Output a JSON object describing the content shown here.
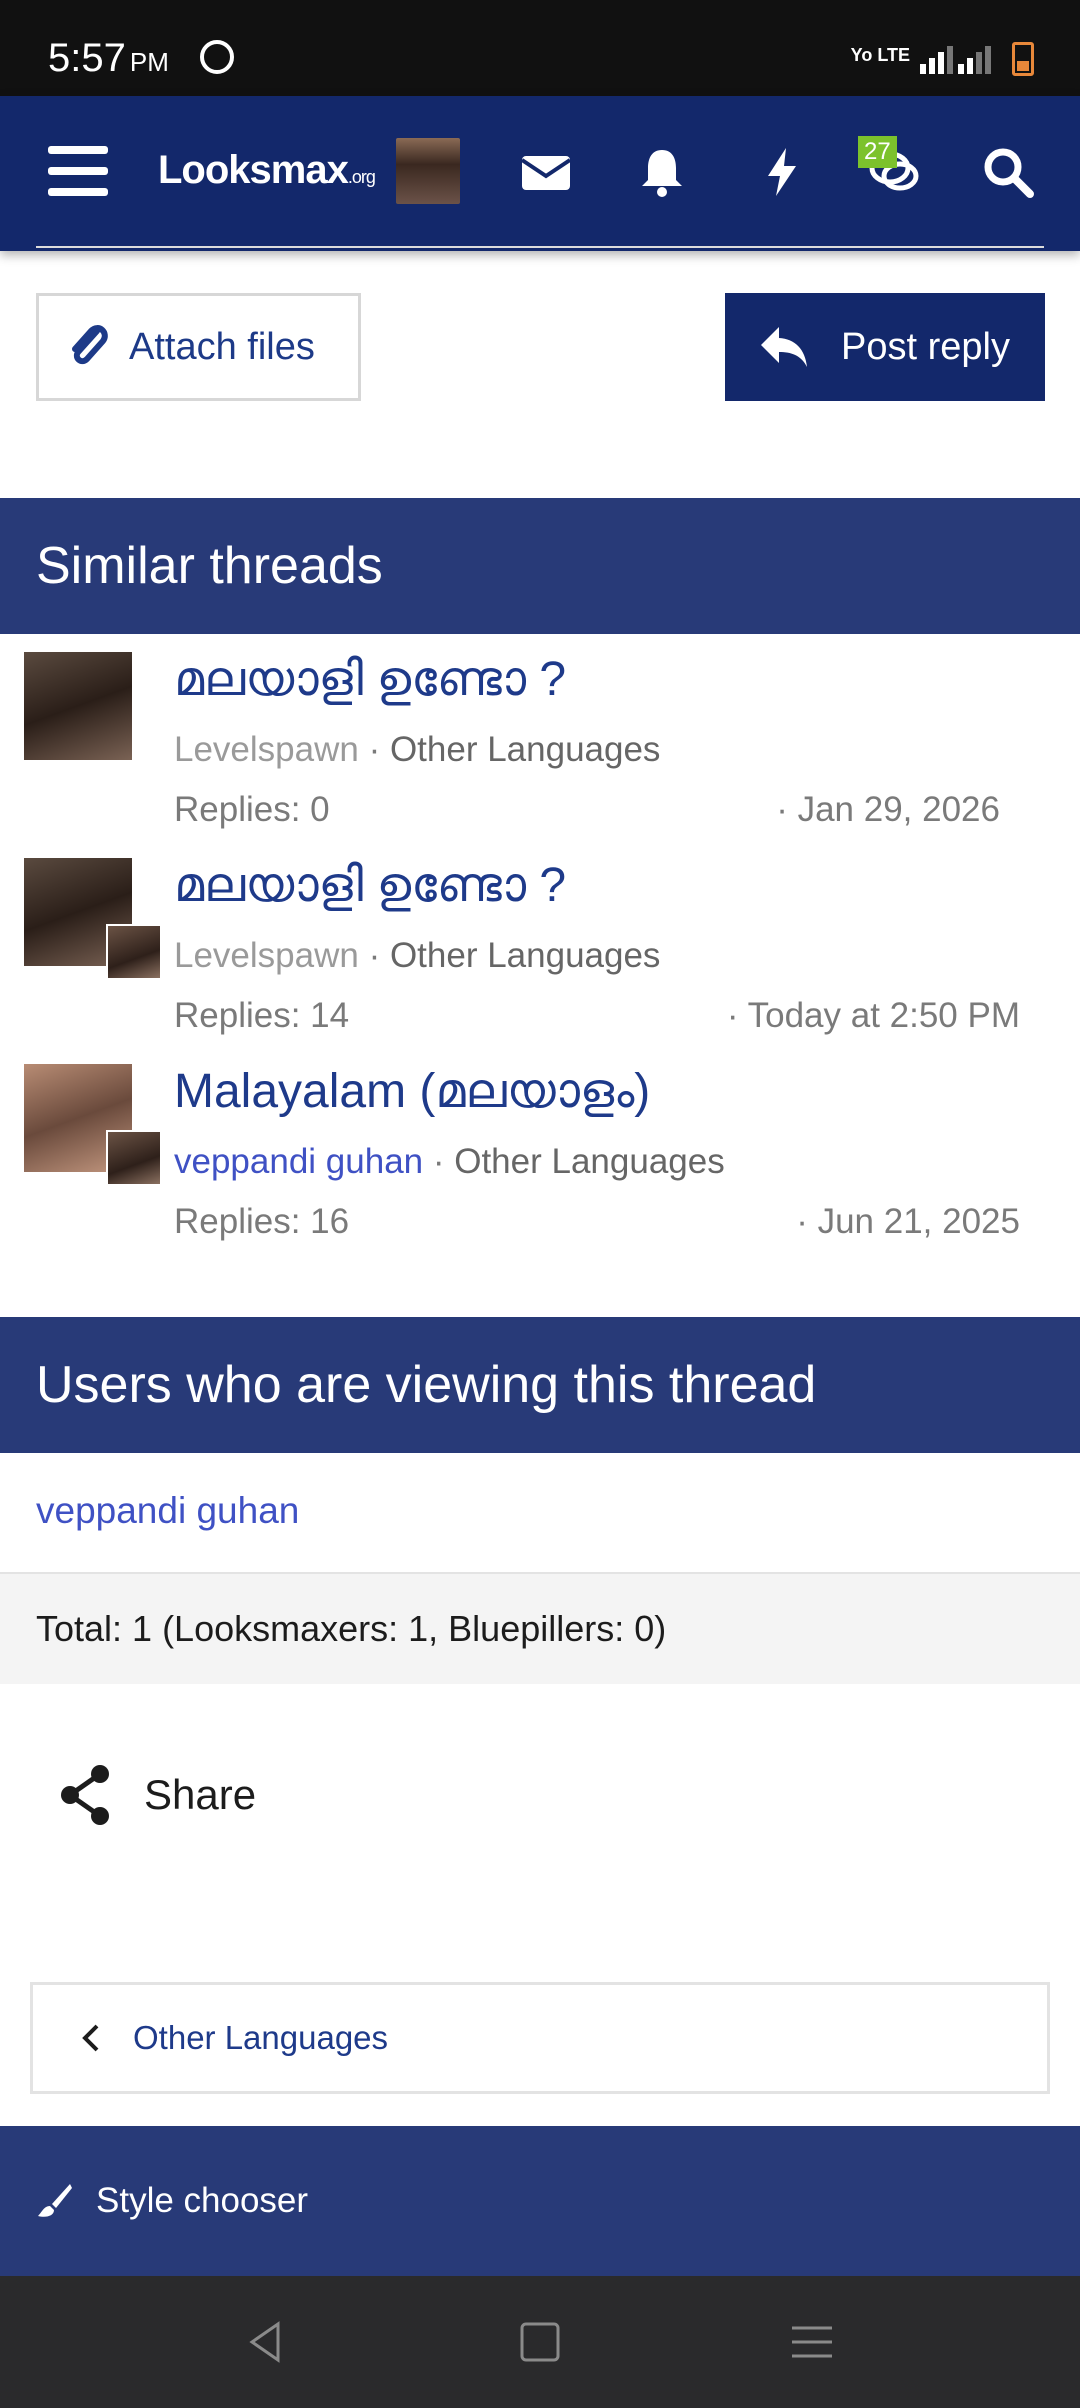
{
  "status_bar": {
    "time": "5:57",
    "ampm": "PM",
    "network": "Yo LTE",
    "lte": "LTE"
  },
  "header": {
    "logo_main": "Looksmax",
    "logo_suffix": ".org",
    "conversations_badge": "27",
    "icons": [
      "menu-icon",
      "avatar",
      "envelope-icon",
      "bell-icon",
      "lightning-icon",
      "chat-icon",
      "search-icon"
    ]
  },
  "actions": {
    "attach_label": "Attach files",
    "post_reply_label": "Post reply"
  },
  "similar_threads": {
    "heading": "Similar threads",
    "items": [
      {
        "title": "മലയാളി ഉണ്ടോ ?",
        "user": "Levelspawn",
        "forum": "Other Languages",
        "replies": "Replies: 0",
        "date": "Jan 29, 2026"
      },
      {
        "title": "മലയാളി ഉണ്ടോ ?",
        "user": "Levelspawn",
        "forum": "Other Languages",
        "replies": "Replies: 14",
        "date": "Today at 2:50 PM"
      },
      {
        "title": "Malayalam (മലയാളം)",
        "user": "veppandi guhan",
        "forum": "Other Languages",
        "replies": "Replies: 16",
        "date": "Jun 21, 2025"
      }
    ]
  },
  "viewers": {
    "heading": "Users who are viewing this thread",
    "user": "veppandi guhan",
    "total": "Total: 1 (Looksmaxers: 1, Bluepillers: 0)"
  },
  "share_label": "Share",
  "breadcrumb_label": "Other Languages",
  "footer": {
    "style_chooser": "Style chooser"
  },
  "colors": {
    "nav_bg": "#13286b",
    "section_bg": "#283a78",
    "link": "#1e3a8a",
    "badge": "#7cc22c"
  }
}
